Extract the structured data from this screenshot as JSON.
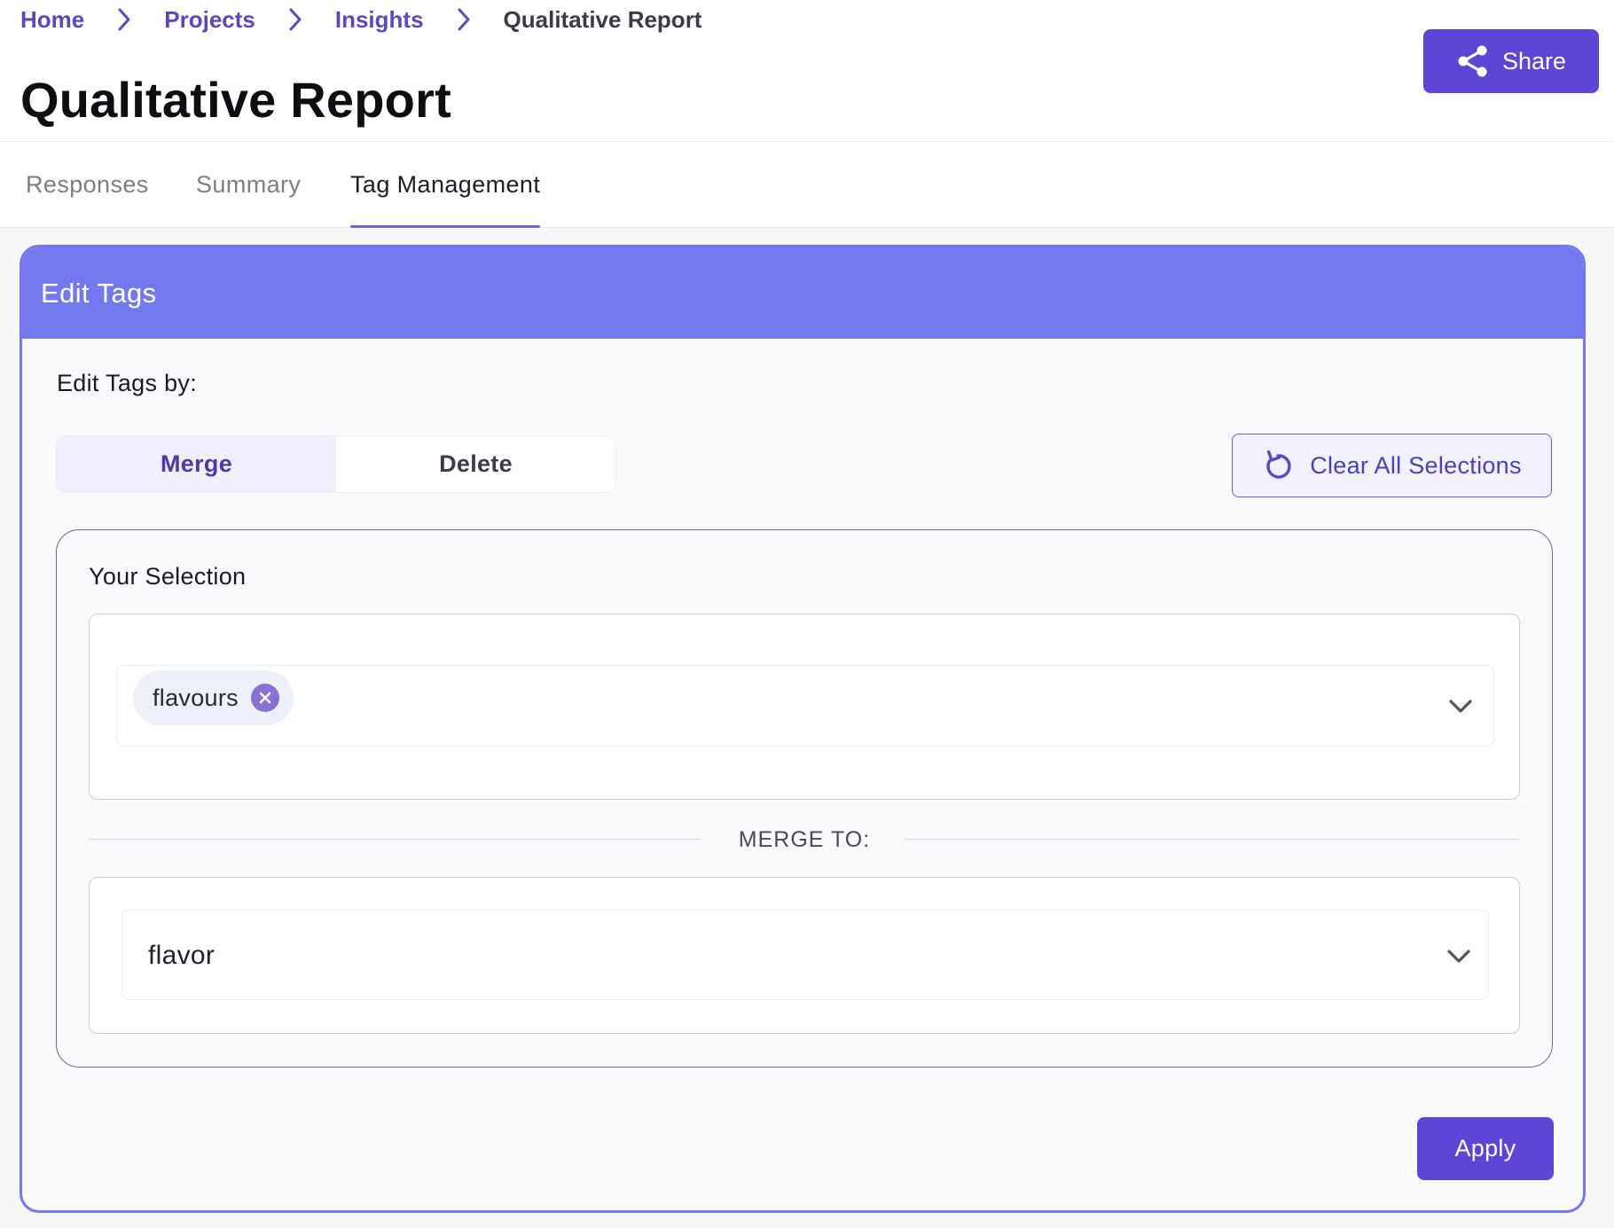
{
  "breadcrumb": {
    "items": [
      {
        "label": "Home"
      },
      {
        "label": "Projects"
      },
      {
        "label": "Insights"
      },
      {
        "label": "Qualitative Report"
      }
    ]
  },
  "header": {
    "title": "Qualitative Report",
    "share_label": "Share"
  },
  "tabs": [
    {
      "label": "Responses",
      "active": false
    },
    {
      "label": "Summary",
      "active": false
    },
    {
      "label": "Tag Management",
      "active": true
    }
  ],
  "card": {
    "title": "Edit Tags",
    "edit_by_label": "Edit Tags by:",
    "modes": [
      {
        "label": "Merge",
        "selected": true
      },
      {
        "label": "Delete",
        "selected": false
      }
    ],
    "clear_label": "Clear All Selections",
    "selection": {
      "label": "Your Selection",
      "chips": [
        "flavours"
      ],
      "merge_to_label": "MERGE TO:",
      "merge_to_value": "flavor"
    },
    "apply_label": "Apply"
  },
  "colors": {
    "accent": "#5b46d6",
    "card_header": "#7278ee",
    "link": "#5a48bf",
    "chip_bg": "#eef0fb",
    "chip_remove": "#8870d4"
  },
  "icons": {
    "share": "share-icon",
    "clear": "refresh-icon",
    "breadcrumb_separator": "chevron-right-icon",
    "dropdown": "chevron-down-icon",
    "chip_remove": "close-circle-icon"
  }
}
